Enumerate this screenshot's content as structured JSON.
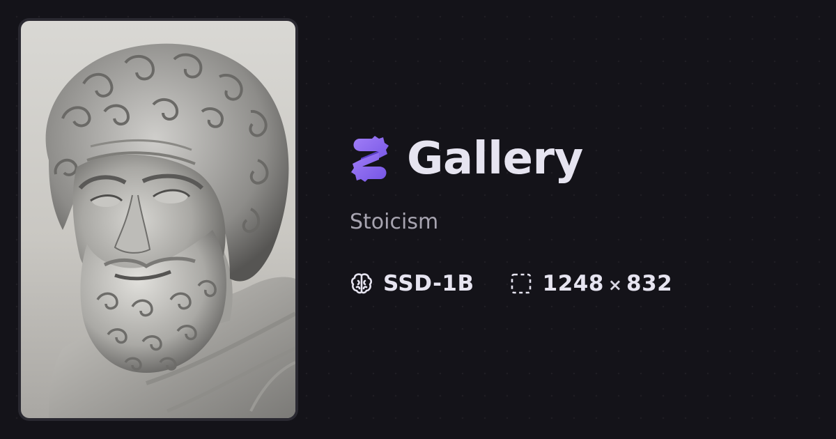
{
  "app": {
    "title": "Gallery",
    "subtitle": "Stoicism",
    "logo_icon": "purple-gear-s-logo-icon",
    "accent_color": "#8b67f0"
  },
  "image": {
    "subject_icon": "bearded-marble-bust-illustration"
  },
  "meta": {
    "model_icon": "brain-icon",
    "model": "SSD-1B",
    "size_icon": "dashed-frame-icon",
    "width": "1248",
    "separator": "×",
    "height": "832"
  }
}
